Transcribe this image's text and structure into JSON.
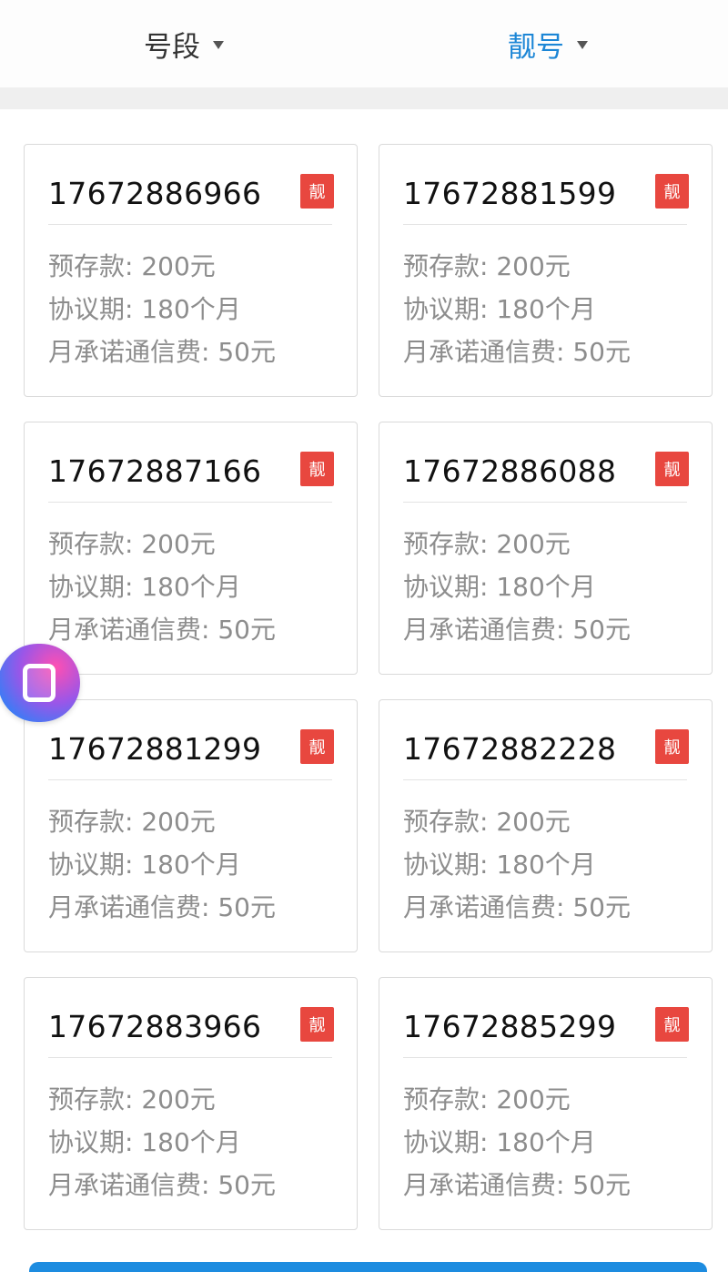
{
  "filters": [
    {
      "label": "号段",
      "active": false
    },
    {
      "label": "靓号",
      "active": true
    }
  ],
  "badge_label": "靓",
  "cards": [
    {
      "number": "17672886966",
      "deposit": "预存款: 200元",
      "term": "协议期: 180个月",
      "monthly": "月承诺通信费: 50元"
    },
    {
      "number": "17672881599",
      "deposit": "预存款: 200元",
      "term": "协议期: 180个月",
      "monthly": "月承诺通信费: 50元"
    },
    {
      "number": "17672887166",
      "deposit": "预存款: 200元",
      "term": "协议期: 180个月",
      "monthly": "月承诺通信费: 50元"
    },
    {
      "number": "17672886088",
      "deposit": "预存款: 200元",
      "term": "协议期: 180个月",
      "monthly": "月承诺通信费: 50元"
    },
    {
      "number": "17672881299",
      "deposit": "预存款: 200元",
      "term": "协议期: 180个月",
      "monthly": "月承诺通信费: 50元"
    },
    {
      "number": "17672882228",
      "deposit": "预存款: 200元",
      "term": "协议期: 180个月",
      "monthly": "月承诺通信费: 50元"
    },
    {
      "number": "17672883966",
      "deposit": "预存款: 200元",
      "term": "协议期: 180个月",
      "monthly": "月承诺通信费: 50元"
    },
    {
      "number": "17672885299",
      "deposit": "预存款: 200元",
      "term": "协议期: 180个月",
      "monthly": "月承诺通信费: 50元"
    }
  ],
  "colors": {
    "accent": "#1c86d6",
    "badge": "#e8473f",
    "bottom_bar": "#1d8ce0"
  }
}
